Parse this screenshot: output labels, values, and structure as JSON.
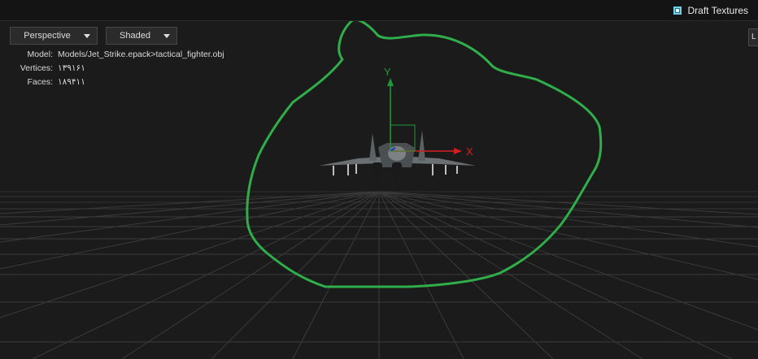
{
  "topbar": {
    "draft_textures_label": "Draft Textures",
    "draft_textures_checked": true
  },
  "viewport": {
    "view_mode": "Perspective",
    "shading_mode": "Shaded",
    "edge_tab_label": "L"
  },
  "model_info": {
    "model_key": "Model:",
    "model_value": "Models/Jet_Strike.epack>tactical_fighter.obj",
    "vertices_key": "Vertices:",
    "vertices_value": "۱۳۹۱۶۱",
    "faces_key": "Faces:",
    "faces_value": "۱۸۹۴۱۱"
  },
  "gizmo": {
    "x_label": "X",
    "y_label": "Y",
    "x_color": "#d41f1f",
    "y_color": "#1f9a33",
    "z_color": "#2a2ad8"
  },
  "annotation": {
    "stroke_color": "#2fae4a"
  },
  "colors": {
    "background": "#1b1b1b",
    "grid": "#3a3a3a"
  }
}
